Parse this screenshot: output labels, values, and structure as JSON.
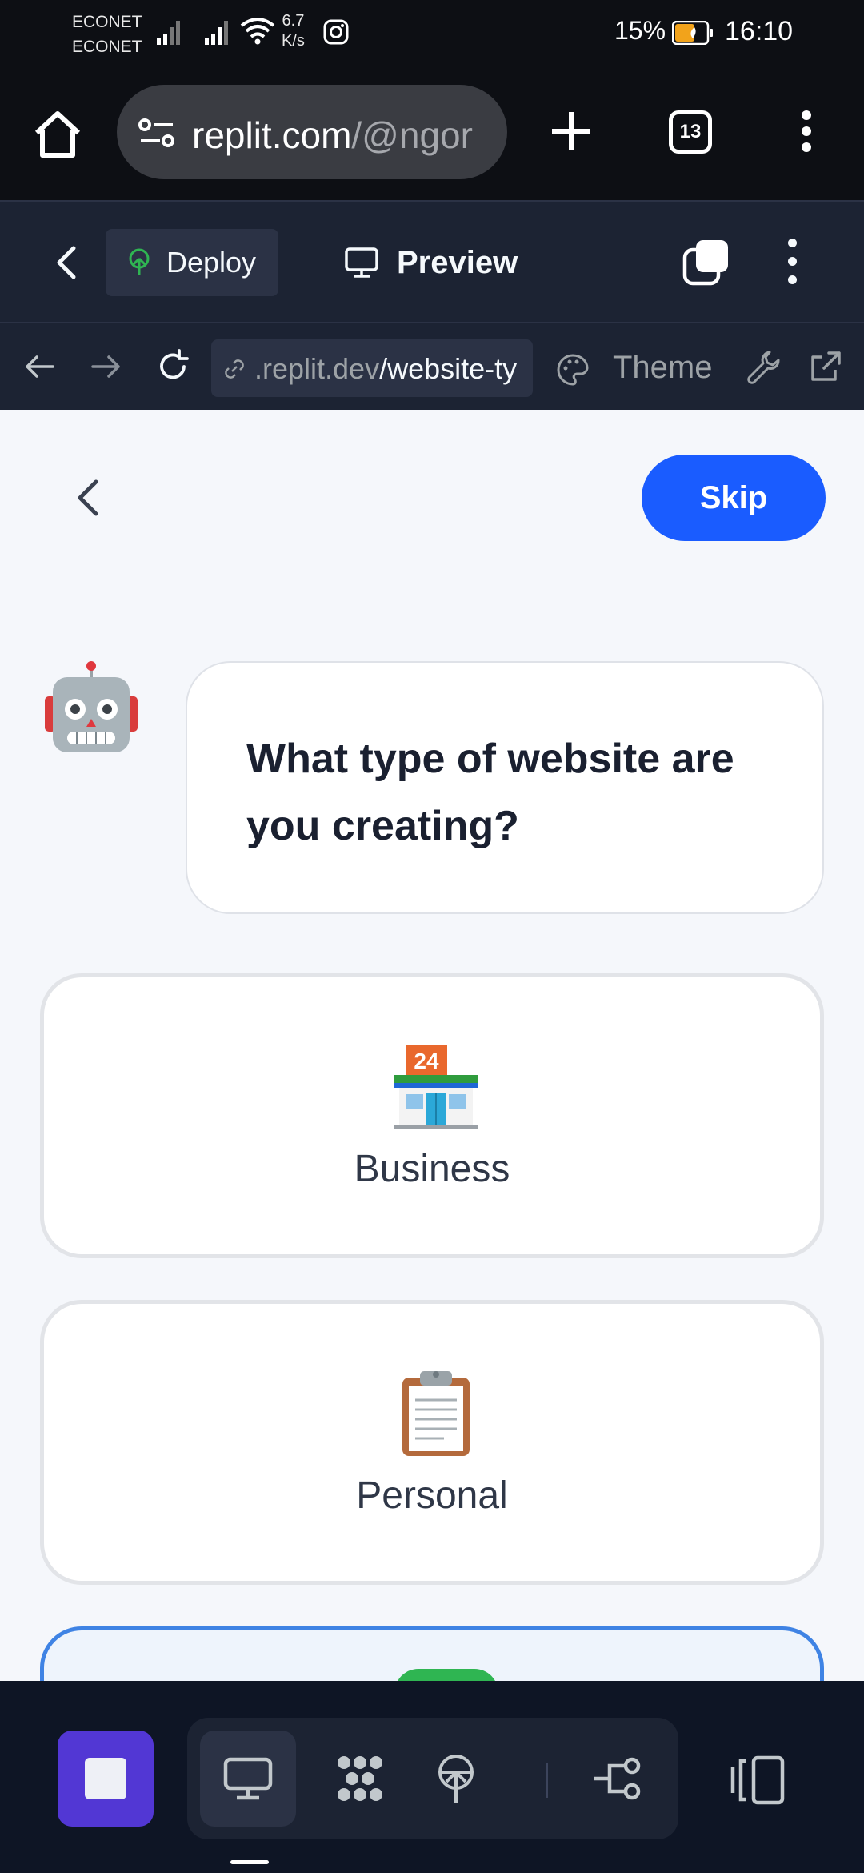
{
  "status_bar": {
    "carrier_1": "ECONET",
    "carrier_2": "ECONET",
    "net_speed_value": "6.7",
    "net_speed_unit": "K/s",
    "battery_percent": "15%",
    "time": "16:10"
  },
  "browser": {
    "url_host": "replit.com",
    "url_path": "/@ngor",
    "tab_count": "13"
  },
  "replit_header": {
    "deploy_label": "Deploy",
    "preview_label": "Preview"
  },
  "preview_toolbar": {
    "address_prefix": ".replit.dev",
    "address_path": "/website-ty",
    "theme_label": "Theme"
  },
  "page": {
    "skip_label": "Skip",
    "question": "What type of website are you creating?",
    "options": [
      {
        "label": "Business",
        "icon": "convenience-store-icon"
      },
      {
        "label": "Personal",
        "icon": "clipboard-icon"
      }
    ]
  },
  "colors": {
    "accent_blue": "#1a5cff",
    "stop_purple": "#5237d4",
    "ide_background": "#1c2333",
    "selected_border": "#3f83e4"
  }
}
